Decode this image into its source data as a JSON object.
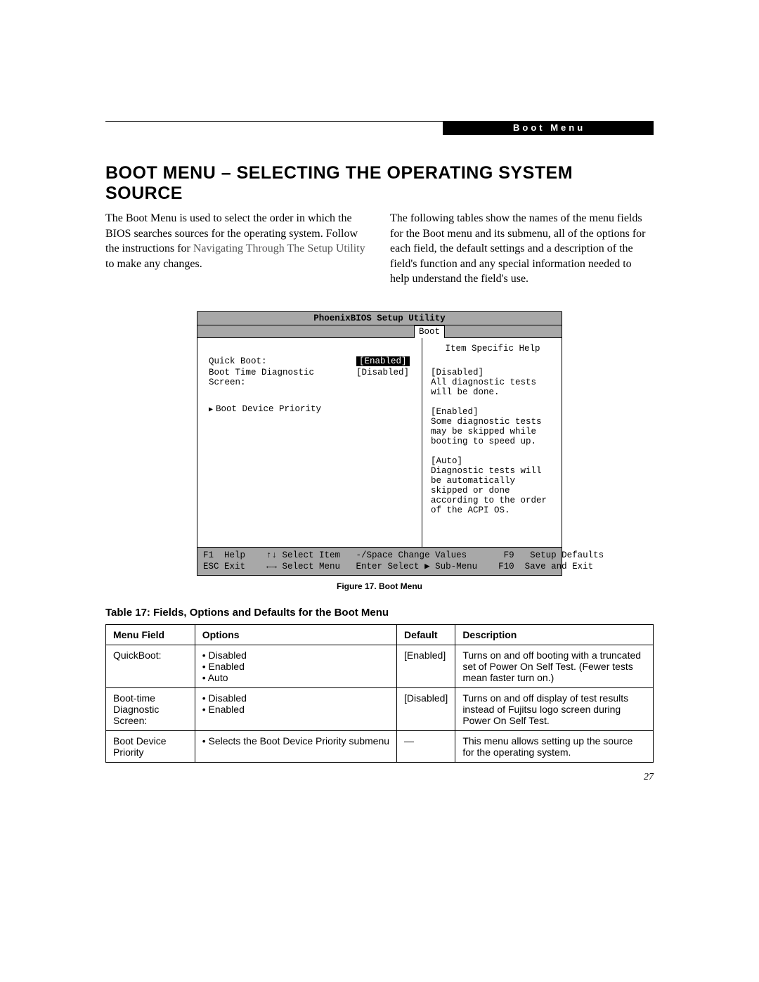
{
  "header": {
    "section_label": "Boot Menu"
  },
  "title": "BOOT MENU – SELECTING THE OPERATING SYSTEM SOURCE",
  "intro": {
    "col1_a": "The Boot Menu is used to select the order in which the BIOS searches sources for the operating system. Follow the instructions for ",
    "col1_link": "Navigating Through The Setup Utility",
    "col1_b": " to make any changes.",
    "col2": "The following tables show the names of the menu fields for the Boot menu and its submenu, all of the options for each field, the default settings and a description of the field's function and any special information needed to help understand the field's use."
  },
  "bios": {
    "title": "PhoenixBIOS Setup Utility",
    "tab": "Boot",
    "rows": [
      {
        "label": "Quick Boot:",
        "value": "[Enabled]",
        "selected": true
      },
      {
        "label": "Boot Time Diagnostic Screen:",
        "value": "[Disabled]",
        "selected": false
      }
    ],
    "submenu": "Boot Device Priority",
    "help_title": "Item Specific Help",
    "help_blocks": [
      "[Disabled]\nAll diagnostic tests will be done.",
      "[Enabled]\nSome diagnostic tests may be skipped while booting to speed up.",
      "[Auto]\nDiagnostic tests will be automatically skipped or done according to the order of the ACPI OS."
    ],
    "footer": {
      "line1": {
        "c1": "F1  Help    ",
        "c2": "↑↓ Select Item   ",
        "c3": "-/Space Change Values       ",
        "c4": "F9   Setup Defaults"
      },
      "line2": {
        "c1": "ESC Exit    ",
        "c2": "←→ Select Menu   ",
        "c3": "Enter Select ▶ Sub-Menu    ",
        "c4": "F10  Save and Exit"
      }
    }
  },
  "figure_caption": "Figure 17.  Boot Menu",
  "table": {
    "title": "Table 17: Fields, Options and Defaults for the Boot Menu",
    "headers": [
      "Menu Field",
      "Options",
      "Default",
      "Description"
    ],
    "rows": [
      {
        "field": "QuickBoot:",
        "options": [
          "Disabled",
          "Enabled",
          "Auto"
        ],
        "default": "[Enabled]",
        "desc": "Turns on and off booting with a truncated set of Power On Self Test. (Fewer tests mean faster turn on.)"
      },
      {
        "field": "Boot-time Diagnostic Screen:",
        "options": [
          "Disabled",
          "Enabled"
        ],
        "default": "[Disabled]",
        "desc": "Turns on and off display of test results instead of Fujitsu logo screen during Power On Self Test."
      },
      {
        "field": "Boot Device Priority",
        "options": [
          "Selects the Boot Device Priority submenu"
        ],
        "default": "—",
        "desc": "This menu allows setting up the source for the operating system."
      }
    ]
  },
  "page_number": "27"
}
